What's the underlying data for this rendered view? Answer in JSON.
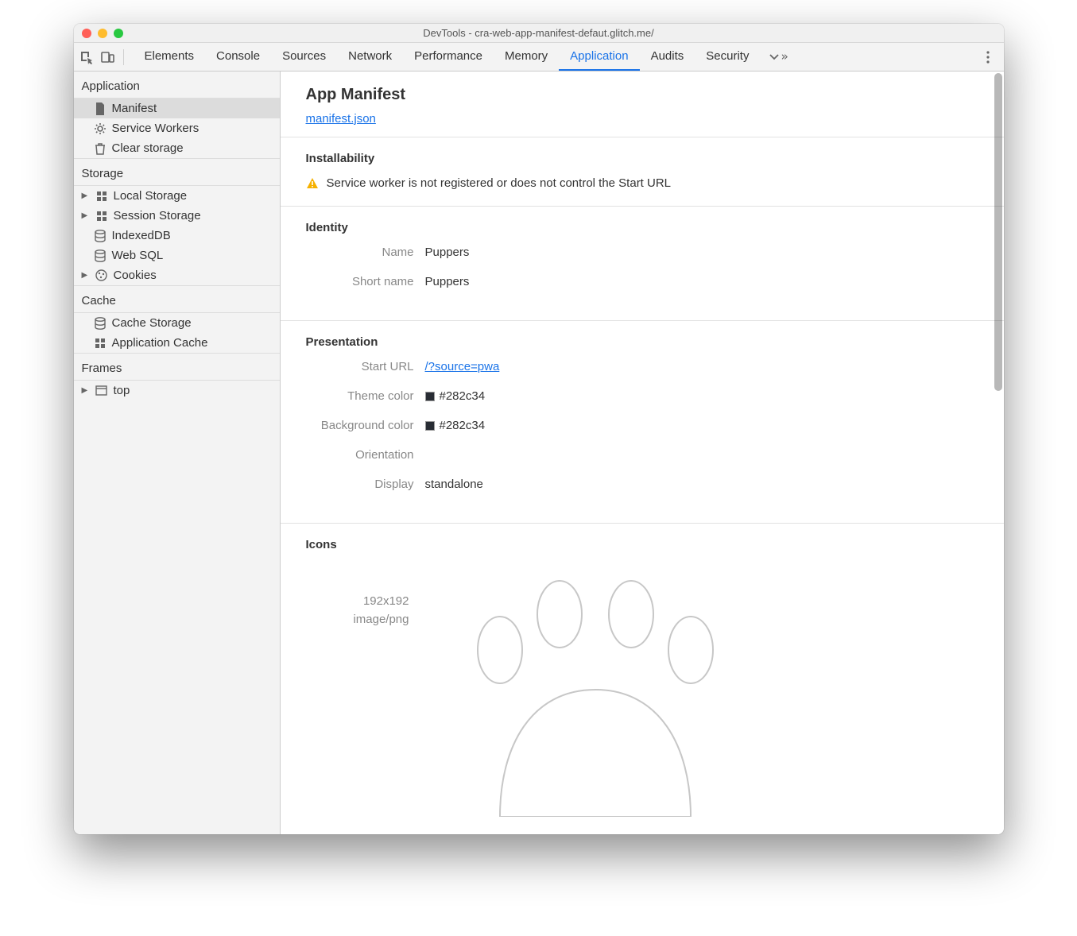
{
  "window": {
    "title": "DevTools - cra-web-app-manifest-defaut.glitch.me/"
  },
  "tabs": {
    "items": [
      "Elements",
      "Console",
      "Sources",
      "Network",
      "Performance",
      "Memory",
      "Application",
      "Audits",
      "Security"
    ],
    "active_index": 6
  },
  "sidebar": {
    "sections": [
      {
        "title": "Application",
        "items": [
          {
            "label": "Manifest",
            "icon": "document-icon",
            "selected": true
          },
          {
            "label": "Service Workers",
            "icon": "gear-icon"
          },
          {
            "label": "Clear storage",
            "icon": "trash-icon"
          }
        ]
      },
      {
        "title": "Storage",
        "items": [
          {
            "label": "Local Storage",
            "icon": "grid-icon",
            "expandable": true
          },
          {
            "label": "Session Storage",
            "icon": "grid-icon",
            "expandable": true
          },
          {
            "label": "IndexedDB",
            "icon": "database-icon"
          },
          {
            "label": "Web SQL",
            "icon": "database-icon"
          },
          {
            "label": "Cookies",
            "icon": "cookie-icon",
            "expandable": true
          }
        ]
      },
      {
        "title": "Cache",
        "items": [
          {
            "label": "Cache Storage",
            "icon": "database-icon"
          },
          {
            "label": "Application Cache",
            "icon": "grid-icon"
          }
        ]
      },
      {
        "title": "Frames",
        "items": [
          {
            "label": "top",
            "icon": "window-icon",
            "expandable": true
          }
        ]
      }
    ]
  },
  "main": {
    "title": "App Manifest",
    "manifest_link": "manifest.json",
    "installability": {
      "title": "Installability",
      "warning": "Service worker is not registered or does not control the Start URL"
    },
    "identity": {
      "title": "Identity",
      "name_label": "Name",
      "name_value": "Puppers",
      "short_name_label": "Short name",
      "short_name_value": "Puppers"
    },
    "presentation": {
      "title": "Presentation",
      "start_url_label": "Start URL",
      "start_url_value": "/?source=pwa",
      "theme_color_label": "Theme color",
      "theme_color_value": "#282c34",
      "background_color_label": "Background color",
      "background_color_value": "#282c34",
      "orientation_label": "Orientation",
      "orientation_value": "",
      "display_label": "Display",
      "display_value": "standalone"
    },
    "icons": {
      "title": "Icons",
      "size": "192x192",
      "mime": "image/png"
    }
  }
}
